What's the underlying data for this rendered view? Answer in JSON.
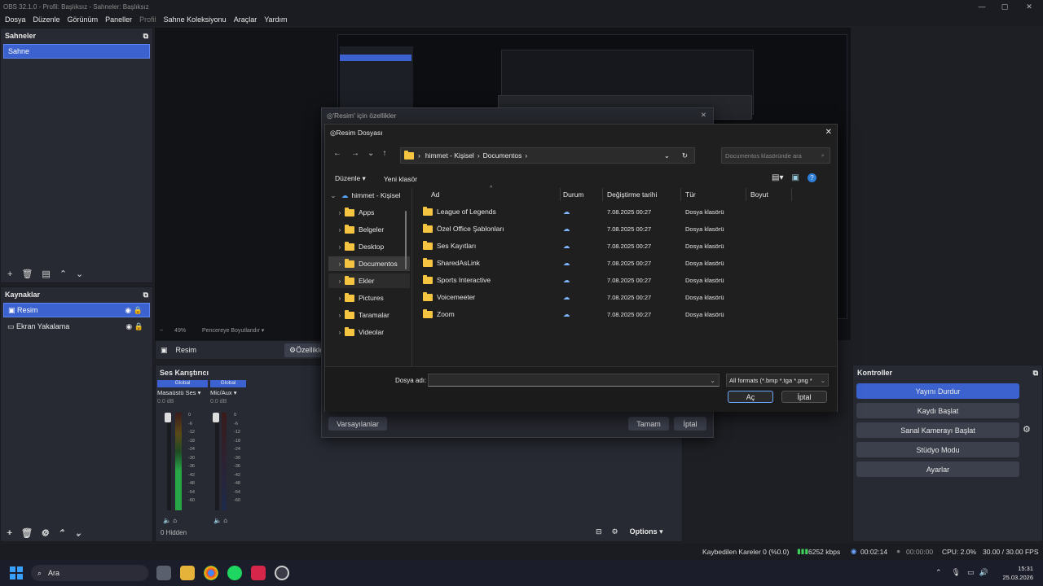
{
  "window": {
    "title": "OBS 32.1.0 - Profil: Başlıksız - Sahneler: Başlıksız"
  },
  "menu": [
    "Dosya",
    "Düzenle",
    "Görünüm",
    "Paneller",
    "Profil",
    "Sahne Koleksiyonu",
    "Araçlar",
    "Yardım"
  ],
  "scenes": {
    "title": "Sahneler",
    "items": [
      "Sahne"
    ]
  },
  "sources": {
    "title": "Kaynaklar",
    "items": [
      "Resim",
      "Ekran Yakalama"
    ]
  },
  "preview": {
    "zoom": "49%",
    "fit_label": "Pencereye Boyutlandır"
  },
  "source_bar": {
    "source_name": "Resim",
    "properties_button": "Özellikler"
  },
  "mixer": {
    "title": "Ses Karıştırıcı",
    "channels": [
      {
        "badge": "Global",
        "name": "Masaüstü Ses",
        "db": "0.0 dB"
      },
      {
        "badge": "Global",
        "name": "Mic/Aux",
        "db": "0.0 dB"
      }
    ],
    "scale": [
      "0",
      "-6",
      "-12",
      "-18",
      "-24",
      "-30",
      "-36",
      "-42",
      "-48",
      "-54",
      "-60"
    ],
    "hidden": "0 Hidden",
    "options": "Options"
  },
  "controls": {
    "title": "Kontroller",
    "buttons": [
      "Yayını Durdur",
      "Kaydı Başlat",
      "Sanal Kamerayı Başlat",
      "Stüdyo Modu",
      "Ayarlar"
    ]
  },
  "props_dialog": {
    "title": "'Resim' için özellikler",
    "defaults": "Varsayılanlar",
    "ok": "Tamam",
    "cancel": "İptal"
  },
  "file_dialog": {
    "title": "Resim Dosyası",
    "breadcrumb": [
      "himmet - Kişisel",
      "Documentos"
    ],
    "search_placeholder": "Documentos klasöründe ara",
    "organize": "Düzenle",
    "new_folder": "Yeni klasör",
    "nav_root": "himmet - Kişisel",
    "nav_items": [
      "Apps",
      "Belgeler",
      "Desktop",
      "Documentos",
      "Ekler",
      "Pictures",
      "Taramalar",
      "Videolar"
    ],
    "columns": [
      "Ad",
      "Durum",
      "Değiştirme tarihi",
      "Tür",
      "Boyut"
    ],
    "files": [
      {
        "name": "League of Legends",
        "date": "7.08.2025 00:27",
        "type": "Dosya klasörü"
      },
      {
        "name": "Özel Office Şablonları",
        "date": "7.08.2025 00:27",
        "type": "Dosya klasörü"
      },
      {
        "name": "Ses Kayıtları",
        "date": "7.08.2025 00:27",
        "type": "Dosya klasörü"
      },
      {
        "name": "SharedAsLink",
        "date": "7.08.2025 00:27",
        "type": "Dosya klasörü"
      },
      {
        "name": "Sports Interactive",
        "date": "7.08.2025 00:27",
        "type": "Dosya klasörü"
      },
      {
        "name": "Voicemeeter",
        "date": "7.08.2025 00:27",
        "type": "Dosya klasörü"
      },
      {
        "name": "Zoom",
        "date": "7.08.2025 00:27",
        "type": "Dosya klasörü"
      }
    ],
    "filename_label": "Dosya adı:",
    "filename_value": "",
    "filter": "All formats (*.bmp *.tga *.png *",
    "open": "Aç",
    "cancel": "İptal"
  },
  "status": {
    "dropped": "Kaybedilen Kareler 0 (%0.0)",
    "bitrate": "6252 kbps",
    "stream_time": "00:02:14",
    "rec_time": "00:00:00",
    "cpu": "CPU: 2.0%",
    "fps": "30.00 / 30.00 FPS"
  },
  "taskbar": {
    "search": "Ara",
    "time": "15:31",
    "date": "25.03.2026"
  }
}
